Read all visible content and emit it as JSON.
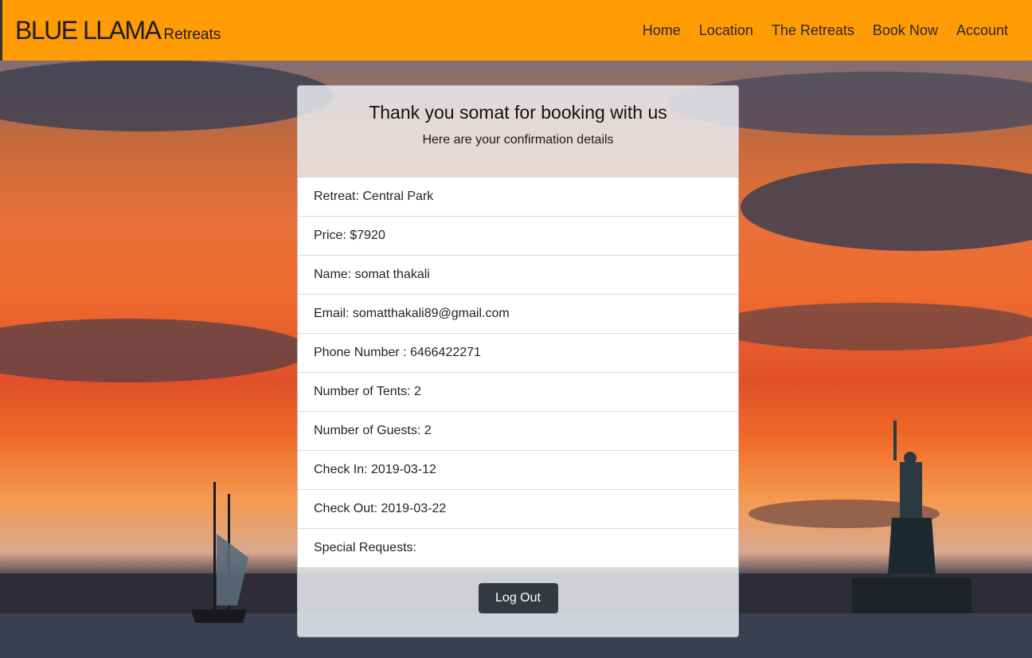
{
  "navbar": {
    "brand_main": "BLUE LLAMA",
    "brand_sub": "Retreats",
    "links": [
      "Home",
      "Location",
      "The Retreats",
      "Book Now",
      "Account"
    ],
    "background_color": "#ff9b05"
  },
  "confirmation": {
    "title": "Thank you somat for booking with us",
    "subtitle": "Here are your confirmation details",
    "details": [
      "Retreat: Central Park",
      "Price: $7920",
      "Name: somat thakali",
      "Email: somatthakali89@gmail.com",
      "Phone Number : 6466422271",
      "Number of Tents: 2",
      "Number of Guests: 2",
      "Check In: 2019-03-12",
      "Check Out: 2019-03-22",
      "Special Requests:"
    ],
    "logout_label": "Log Out"
  }
}
